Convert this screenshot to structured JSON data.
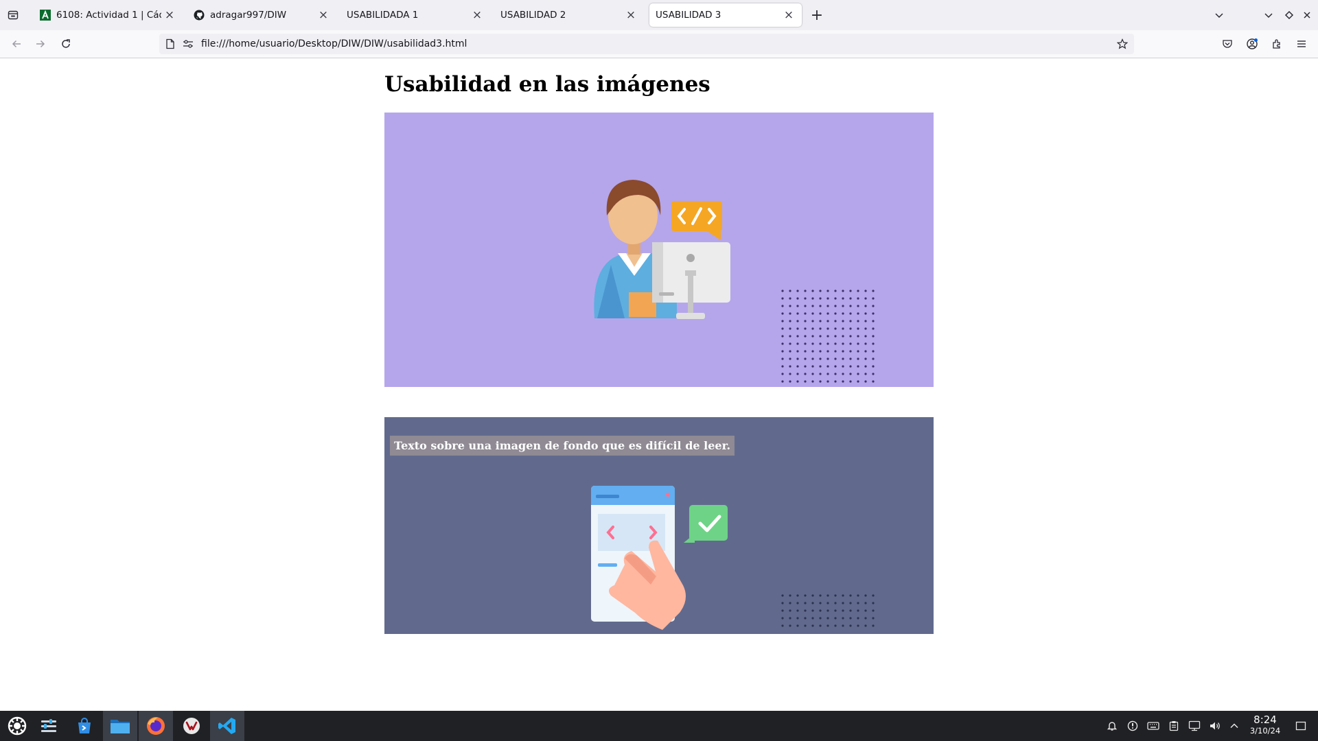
{
  "browser": {
    "tabs": [
      {
        "title": "6108: Actividad 1 | Cádiz",
        "icon": "aula-green-a-icon",
        "active": false
      },
      {
        "title": "adragar997/DIW",
        "icon": "github-icon",
        "active": false
      },
      {
        "title": "USABILIDADA 1",
        "icon": "",
        "active": false
      },
      {
        "title": "USABILIDAD 2",
        "icon": "",
        "active": false
      },
      {
        "title": "USABILIDAD 3",
        "icon": "",
        "active": true
      }
    ],
    "url": "file:///home/usuario/Desktop/DIW/DIW/usabilidad3.html",
    "new_tab_glyph": "+",
    "close_glyph": "×"
  },
  "page": {
    "title": "Usabilidad en las imágenes",
    "illustration_1": {
      "icon": "programmer-at-computer-illustration",
      "bg": "#b5a6eb"
    },
    "illustration_2": {
      "icon": "hand-swiping-mobile-screen-illustration",
      "bg": "#616a8d",
      "caption": "Texto sobre una imagen de fondo que es difícil de leer."
    }
  },
  "taskbar": {
    "apps": [
      "kde-launcher-icon",
      "system-settings-icon",
      "discover-store-icon",
      "dolphin-files-icon",
      "firefox-icon",
      "vivaldi-icon",
      "vscode-icon"
    ],
    "clock_time": "8:24",
    "clock_date": "3/10/24"
  },
  "colors": {
    "tabstrip_bg": "#f0f0f4",
    "page_bg": "#ffffff",
    "illus1_bg": "#b5a6eb",
    "illus2_bg": "#616a8d",
    "taskbar_bg": "#202124"
  }
}
